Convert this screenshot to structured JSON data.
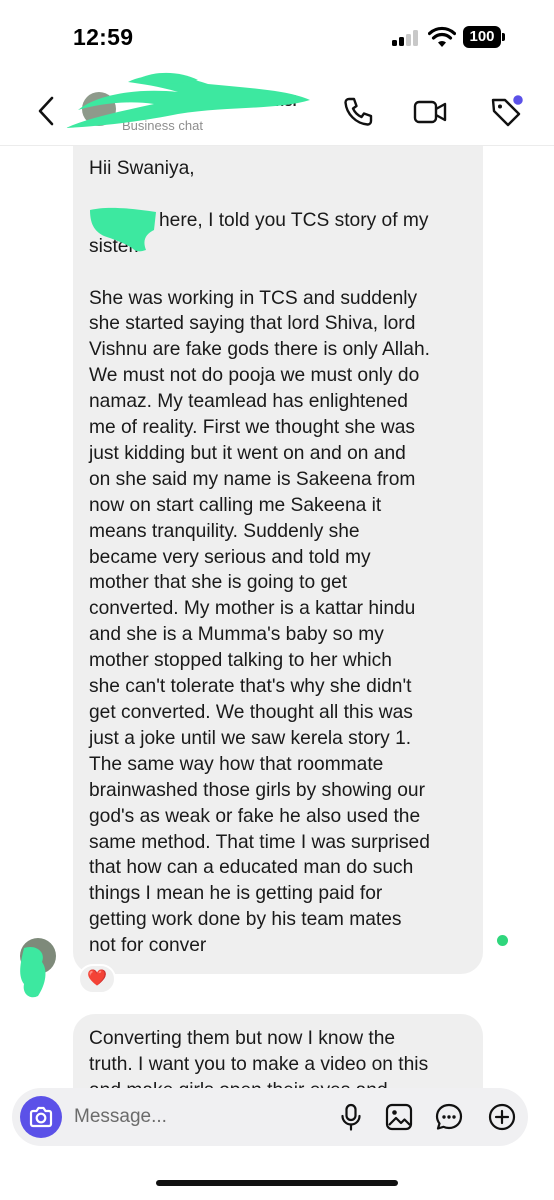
{
  "status_bar": {
    "time": "12:59",
    "battery": "100"
  },
  "header": {
    "contact_name": "andansi",
    "contact_status": "Business chat"
  },
  "messages": {
    "first": {
      "lines": [
        "Hii Swaniya,",
        "",
        "here, I told you TCS story of my",
        "sister.",
        "",
        "She was working in TCS and suddenly",
        "she started saying that lord Shiva, lord",
        "Vishnu are fake gods there is only Allah.",
        "We must not do pooja we must only do",
        "namaz. My teamlead has enlightened",
        "me of reality. First we thought she was",
        "just kidding but it went on and on and",
        "on she said my name is Sakeena from",
        "now on start calling me Sakeena it",
        "means tranquility. Suddenly she",
        "became very serious and told my",
        "mother that she is going to get",
        "converted. My mother is a kattar hindu",
        "and she is a Mumma's baby so my",
        "mother stopped talking to her which",
        "she can't tolerate that's why she didn't",
        "get converted. We thought all this was",
        "just a joke until we saw kerela story 1.",
        "The same way how that roommate",
        "brainwashed those girls by showing our",
        "god's as weak or fake he also used the",
        "same method. That time I was surprised",
        "that how can a educated man do such",
        "things I mean he is getting paid for",
        "getting work done by his team mates",
        "not for conver"
      ],
      "reaction": "❤️"
    },
    "second": {
      "lines": [
        "Converting them but now I know the",
        "truth. I want you to make a video on this",
        "and make girls open their eyes and"
      ]
    }
  },
  "composer": {
    "placeholder": "Message..."
  },
  "colors": {
    "accent": "#5b51e8",
    "scribble": "#3de8a0",
    "online": "#2fd67c",
    "bubble": "#efefef"
  }
}
